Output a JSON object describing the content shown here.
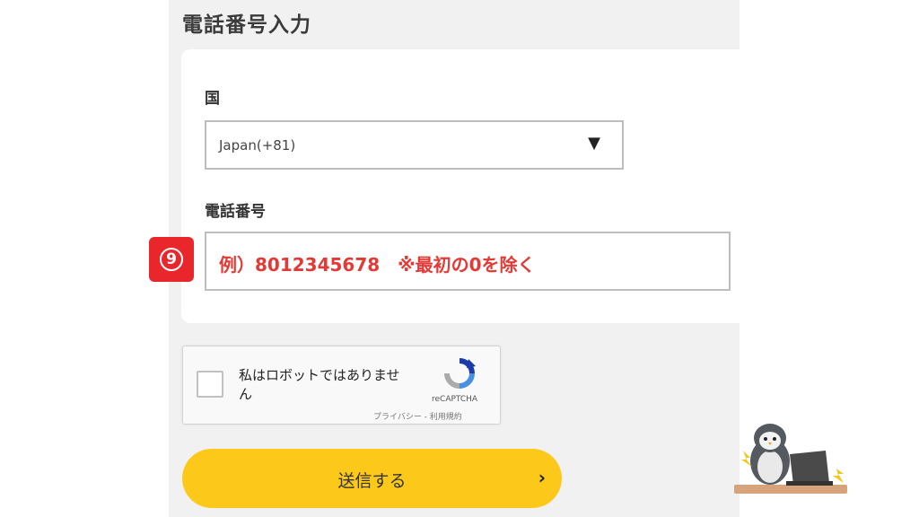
{
  "form": {
    "title": "電話番号入力",
    "country_label": "国",
    "country_value": "Japan(+81)",
    "dropdown_arrow": "▼",
    "phone_label": "電話番号",
    "phone_placeholder": "例）8012345678　※最初の0を除く"
  },
  "annotation": {
    "step_number": "9",
    "color": "#e8262b"
  },
  "recaptcha": {
    "text": "私はロボットではありません",
    "brand": "reCAPTCHA",
    "links": "プライバシー - 利用規約"
  },
  "submit": {
    "label": "送信する",
    "chevron": "›",
    "color": "#fcc91b"
  },
  "icons": [
    "chevron-down-icon",
    "recaptcha-logo-icon",
    "chevron-right-icon",
    "penguin-mascot"
  ]
}
